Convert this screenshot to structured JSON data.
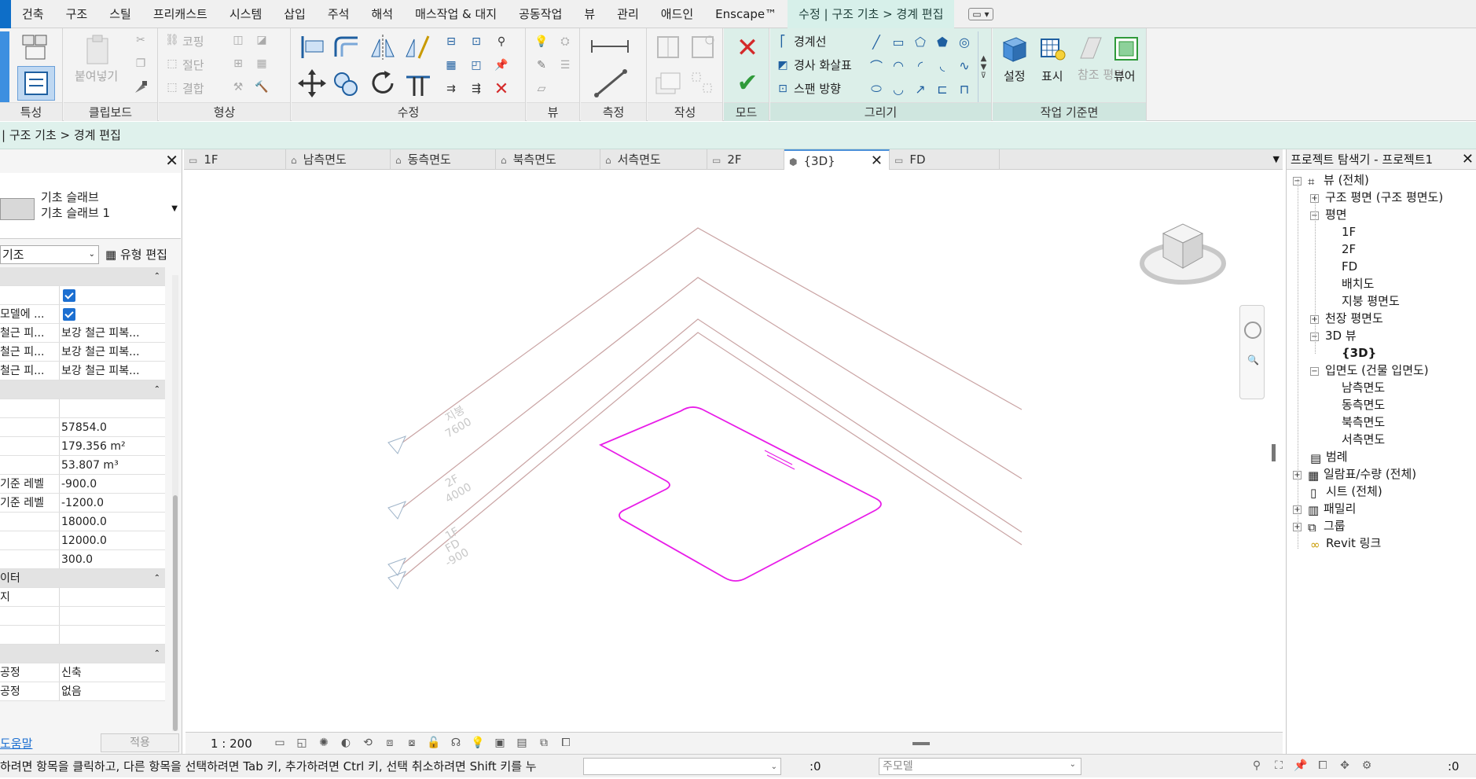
{
  "menu": {
    "items": [
      "건축",
      "구조",
      "스틸",
      "프리캐스트",
      "시스템",
      "삽입",
      "주석",
      "해석",
      "매스작업 & 대지",
      "공동작업",
      "뷰",
      "관리",
      "애드인",
      "Enscape™"
    ],
    "context_tab": "수정 | 구조 기초 > 경계 편집"
  },
  "ribbon": {
    "panels": {
      "properties": "특성",
      "clipboard": "클립보드",
      "geometry": "형상",
      "modify": "수정",
      "view": "뷰",
      "measure": "측정",
      "create": "작성",
      "mode": "모드",
      "draw": "그리기",
      "workplane": "작업 기준면"
    },
    "labels": {
      "paste": "붙여넣기",
      "cope": "코핑",
      "cut": "절단",
      "join": "결합",
      "boundary_line": "경계선",
      "slope_arrow": "경사 화살표",
      "span_direction": "스팬 방향",
      "set": "설정",
      "show": "표시",
      "ref_plane": "참조 평면",
      "viewer": "뷰어"
    }
  },
  "options_bar": {
    "text": "| 구조 기초 > 경계 편집"
  },
  "properties": {
    "type_family": "기초 슬래브",
    "type_name": "기초 슬래브 1",
    "filter_value": "기조",
    "edit_type": "유형 편집",
    "rows": [
      {
        "k": "",
        "v": "",
        "chk": true
      },
      {
        "k": "모델에 ...",
        "v": "",
        "chk": true
      },
      {
        "k": "철근 피...",
        "v": "보강 철근 피복..."
      },
      {
        "k": "철근 피...",
        "v": "보강 철근 피복..."
      },
      {
        "k": "철근 피...",
        "v": "보강 철근 피복..."
      }
    ],
    "dims": [
      {
        "k": "",
        "v": ""
      },
      {
        "k": "",
        "v": "57854.0"
      },
      {
        "k": "",
        "v": "179.356 m²"
      },
      {
        "k": "",
        "v": "53.807 m³"
      },
      {
        "k": "기준 레벨",
        "v": "-900.0"
      },
      {
        "k": "기준 레벨",
        "v": "-1200.0"
      },
      {
        "k": "",
        "v": "18000.0"
      },
      {
        "k": "",
        "v": "12000.0"
      },
      {
        "k": "",
        "v": "300.0"
      }
    ],
    "ident_header": "이터",
    "ident": [
      {
        "k": "지",
        "v": ""
      },
      {
        "k": "",
        "v": ""
      },
      {
        "k": "",
        "v": ""
      }
    ],
    "phase": [
      {
        "k": "공정",
        "v": "신축"
      },
      {
        "k": "공정",
        "v": "없음"
      }
    ],
    "help": "도움말",
    "apply": "적용"
  },
  "tabs": [
    {
      "label": "1F",
      "icon": "plan-view-icon"
    },
    {
      "label": "남측면도",
      "icon": "elevation-icon"
    },
    {
      "label": "동측면도",
      "icon": "elevation-icon"
    },
    {
      "label": "북측면도",
      "icon": "elevation-icon"
    },
    {
      "label": "서측면도",
      "icon": "elevation-icon"
    },
    {
      "label": "2F",
      "icon": "plan-view-icon"
    },
    {
      "label": "{3D}",
      "icon": "3d-view-icon",
      "active": true
    },
    {
      "label": "FD",
      "icon": "plan-view-icon"
    }
  ],
  "levels": [
    {
      "name": "지붕",
      "elev": "7600"
    },
    {
      "name": "2F",
      "elev": "4000"
    },
    {
      "name": "1F",
      "elev": ""
    },
    {
      "name": "FD",
      "elev": "-900"
    }
  ],
  "viewbar": {
    "scale": "1 : 200"
  },
  "browser": {
    "title": "프로젝트 탐색기 - 프로젝트1",
    "nodes": {
      "views": "뷰 (전체)",
      "struct_plans": "구조 평면 (구조 평면도)",
      "floor_plans": "평면",
      "fp_1f": "1F",
      "fp_2f": "2F",
      "fp_fd": "FD",
      "fp_site": "배치도",
      "fp_roof": "지붕 평면도",
      "ceiling": "천장 평면도",
      "views3d": "3D 뷰",
      "v3d": "{3D}",
      "elevations": "입면도 (건물 입면도)",
      "el_s": "남측면도",
      "el_e": "동측면도",
      "el_n": "북측면도",
      "el_w": "서측면도",
      "legends": "범례",
      "schedules": "일람표/수량 (전체)",
      "sheets": "시트 (전체)",
      "families": "패밀리",
      "groups": "그룹",
      "links": "Revit 링크"
    }
  },
  "status": {
    "text": "하려면 항목을 클릭하고, 다른 항목을 선택하려면 Tab 키, 추가하려면 Ctrl 키, 선택 취소하려면 Shift 키를 누",
    "zero1": ":0",
    "model": "주모델",
    "zero2": ":0"
  },
  "colors": {
    "accent_blue": "#0e6ec8",
    "context_green": "#dff1ec",
    "sketch_magenta": "#e81ce8",
    "cancel_red": "#d42a2a",
    "finish_green": "#2f9a3a"
  }
}
